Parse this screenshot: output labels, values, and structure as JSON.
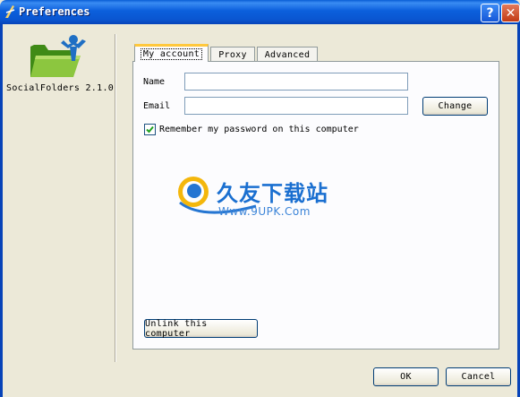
{
  "window": {
    "title": "Preferences",
    "help_glyph": "?",
    "close_glyph": "✕"
  },
  "sidebar": {
    "app_name": "SocialFolders 2.1.0",
    "logo_icon": "socialfolders-folder-logo"
  },
  "tabs": [
    {
      "label": "My account",
      "active": true
    },
    {
      "label": "Proxy",
      "active": false
    },
    {
      "label": "Advanced",
      "active": false
    }
  ],
  "account": {
    "name_label": "Name",
    "name_value": "",
    "email_label": "Email",
    "email_value": "",
    "change_label": "Change",
    "remember_label": "Remember my password on this computer",
    "remember_checked": true,
    "unlink_label": "Unlink this computer"
  },
  "watermark": {
    "text_cn": "久友下载站",
    "url": "Www.9UPK.Com"
  },
  "footer": {
    "ok_label": "OK",
    "cancel_label": "Cancel"
  },
  "colors": {
    "titlebar": "#0a5ed6",
    "dialog_bg": "#ece9d8",
    "active_tab_accent": "#ffc83c",
    "check_green": "#21a121"
  }
}
